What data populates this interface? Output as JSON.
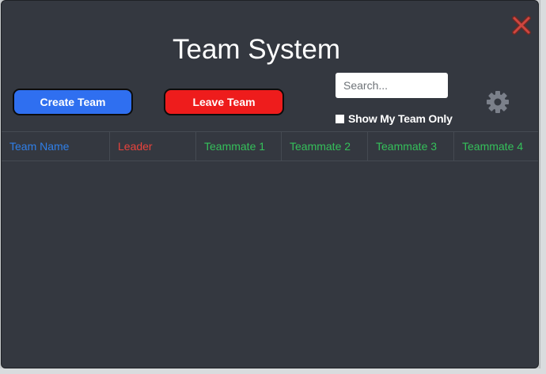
{
  "window": {
    "title": "Team System"
  },
  "toolbar": {
    "create_label": "Create Team",
    "leave_label": "Leave Team",
    "search_placeholder": "Search...",
    "search_value": "",
    "filter_label": "Show My Team Only",
    "filter_checked": false
  },
  "table": {
    "columns": [
      {
        "label": "Team Name",
        "color": "#2f7fe8"
      },
      {
        "label": "Leader",
        "color": "#e8433c"
      },
      {
        "label": "Teammate 1",
        "color": "#34c05a"
      },
      {
        "label": "Teammate 2",
        "color": "#34c05a"
      },
      {
        "label": "Teammate 3",
        "color": "#34c05a"
      },
      {
        "label": "Teammate 4",
        "color": "#34c05a"
      }
    ],
    "rows": []
  },
  "colors": {
    "background": "#343840",
    "create_button": "#2f6ff0",
    "leave_button": "#ee1c1c",
    "gear": "#7b808a",
    "close": "#d0453e"
  },
  "icons": {
    "close": "close-icon",
    "settings": "gear-icon",
    "checkbox": "checkbox-icon"
  }
}
